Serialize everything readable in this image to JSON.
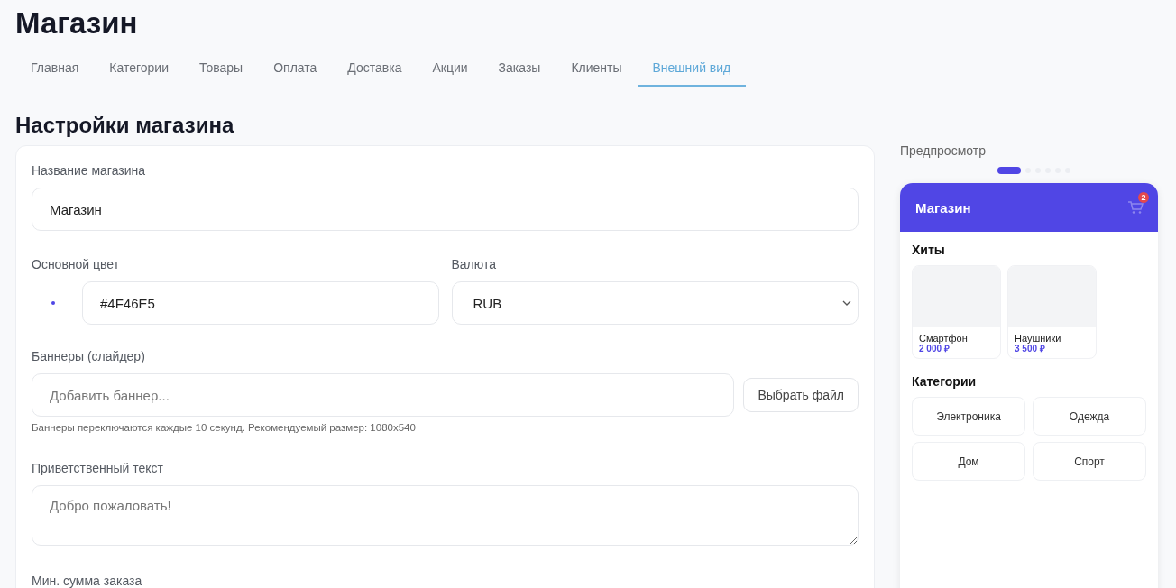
{
  "app_title": "Магазин",
  "tabs": [
    {
      "label": "Главная",
      "selected": false
    },
    {
      "label": "Категории",
      "selected": false
    },
    {
      "label": "Товары",
      "selected": false
    },
    {
      "label": "Оплата",
      "selected": false
    },
    {
      "label": "Доставка",
      "selected": false
    },
    {
      "label": "Акции",
      "selected": false
    },
    {
      "label": "Заказы",
      "selected": false
    },
    {
      "label": "Клиенты",
      "selected": false
    },
    {
      "label": "Внешний вид",
      "selected": true
    }
  ],
  "heading": "Настройки магазина",
  "form": {
    "store_name": {
      "label": "Название магазина",
      "value": "Магазин"
    },
    "primary_color": {
      "label": "Основной цвет",
      "value": "#4F46E5"
    },
    "currency": {
      "label": "Валюта",
      "value": "RUB"
    },
    "banners": {
      "label": "Баннеры (слайдер)",
      "placeholder": "Добавить баннер...",
      "button": "Выбрать файл",
      "hint": "Баннеры переключаются каждые 10 секунд. Рекомендуемый размер: 1080x540"
    },
    "welcome": {
      "label": "Приветственный текст",
      "placeholder": "Добро пожаловать!"
    },
    "min_order": {
      "label": "Мин. сумма заказа"
    }
  },
  "preview": {
    "label": "Предпросмотр",
    "pager": [
      {
        "selected": true
      },
      {
        "selected": false
      },
      {
        "selected": false
      },
      {
        "selected": false
      },
      {
        "selected": false
      },
      {
        "selected": false
      }
    ],
    "store_title": "Магазин",
    "cart_count": "2",
    "hits_title": "Хиты",
    "products": [
      {
        "name": "Смартфон",
        "price": "2 000 ₽"
      },
      {
        "name": "Наушники",
        "price": "3 500 ₽"
      }
    ],
    "categories_title": "Категории",
    "categories": [
      "Электроника",
      "Одежда",
      "Дом",
      "Спорт"
    ]
  }
}
